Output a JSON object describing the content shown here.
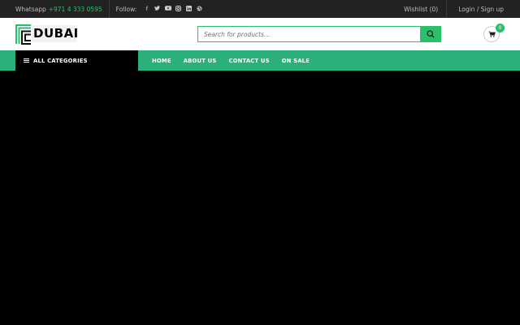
{
  "topbar": {
    "whatsapp_label": "Whatsapp",
    "whatsapp_number": "+971 4 333 0595",
    "follow_label": "Follow:",
    "social": [
      "facebook-icon",
      "twitter-icon",
      "youtube-icon",
      "instagram-icon",
      "linkedin-icon",
      "dribbble-icon"
    ],
    "wishlist": "Wishlist (0)",
    "login": "Login / Sign up"
  },
  "header": {
    "logo_text": "DUBAI",
    "search_placeholder": "Search for products...",
    "cart_count": "0"
  },
  "nav": {
    "all_categories": "ALL CATEGORIES",
    "items": [
      "HOME",
      "ABOUT US",
      "CONTACT US",
      "ON SALE"
    ]
  },
  "colors": {
    "accent": "#2bbf6a",
    "nav_bg": "#2bb07a",
    "topbar_bg": "#222222"
  }
}
